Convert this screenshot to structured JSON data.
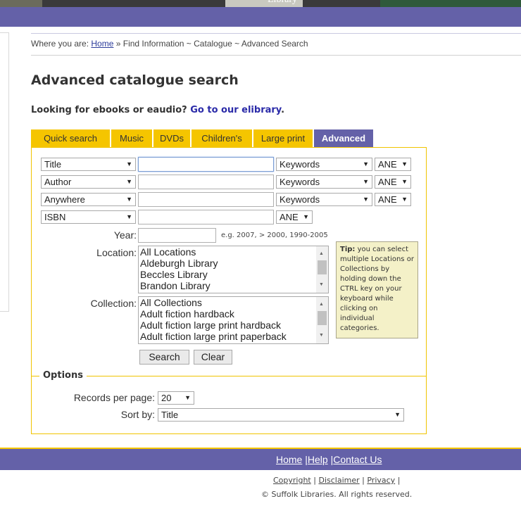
{
  "header": {
    "partial_text": "Library"
  },
  "breadcrumb": {
    "prefix": "Where you are:",
    "home": "Home",
    "rest": "» Find Information ~ Catalogue ~ Advanced Search"
  },
  "page_title": "Advanced catalogue search",
  "ebook": {
    "text": "Looking for ebooks or eaudio?",
    "link": "Go to our elibrary",
    "dot": "."
  },
  "tabs": [
    "Quick search",
    "Music",
    "DVDs",
    "Children's",
    "Large print",
    "Advanced"
  ],
  "active_tab": "Advanced",
  "rows": [
    {
      "field": "Title",
      "type": "Keywords",
      "op": "ANE"
    },
    {
      "field": "Author",
      "type": "Keywords",
      "op": "ANE"
    },
    {
      "field": "Anywhere",
      "type": "Keywords",
      "op": "ANE"
    },
    {
      "field": "ISBN",
      "op": "ANE"
    }
  ],
  "year": {
    "label": "Year:",
    "hint": "e.g. 2007, > 2000, 1990-2005"
  },
  "location": {
    "label": "Location:",
    "items": [
      "All Locations",
      "Aldeburgh Library",
      "Beccles Library",
      "Brandon Library"
    ]
  },
  "collection": {
    "label": "Collection:",
    "items": [
      "All Collections",
      "Adult fiction hardback",
      "Adult fiction large print hardback",
      "Adult fiction large print paperback"
    ]
  },
  "tip": {
    "bold": "Tip:",
    "text": "you can select multiple Locations or Collections by holding down the CTRL key on your keyboard while clicking on individual categories."
  },
  "buttons": {
    "search": "Search",
    "clear": "Clear"
  },
  "options": {
    "legend": "Options",
    "records_label": "Records per page:",
    "records_value": "20",
    "sort_label": "Sort by:",
    "sort_value": "Title"
  },
  "footer": {
    "home": "Home",
    "help": "Help",
    "contact": "Contact Us",
    "sep": "|",
    "copyright_link": "Copyright",
    "disclaimer": "Disclaimer",
    "privacy": "Privacy",
    "copyright": "© Suffolk Libraries. All rights reserved."
  },
  "colors": {
    "brand_purple": "#6461a8",
    "tab_yellow": "#f5c500"
  }
}
